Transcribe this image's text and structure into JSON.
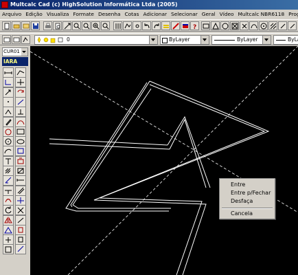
{
  "window": {
    "title": "Multcalc Cad (c) HighSolution Informática Ltda (2005)"
  },
  "menu": [
    "Arquivo",
    "Edição",
    "Visualiza",
    "Formate",
    "Desenha",
    "Cotas",
    "Adicionar",
    "Selecionar",
    "Geral",
    "Vídeo",
    "Multcalc NBR6118",
    "Progr"
  ],
  "layer_toolbar": {
    "layer_value": "0",
    "color_value": "ByLayer",
    "linetype_value": "ByLayer",
    "lineweight_value": "ByLa"
  },
  "left_panel": {
    "cursor_combo": "CUR01",
    "iara_label": "IARA"
  },
  "context_menu": {
    "items": [
      "Entre",
      "Entre p/Fechar",
      "Desfaça",
      "Cancela"
    ]
  },
  "colors": {
    "canvas": "#000000",
    "title_start": "#0a246a",
    "title_end": "#3a6ea5",
    "chrome": "#d4d0c8"
  }
}
